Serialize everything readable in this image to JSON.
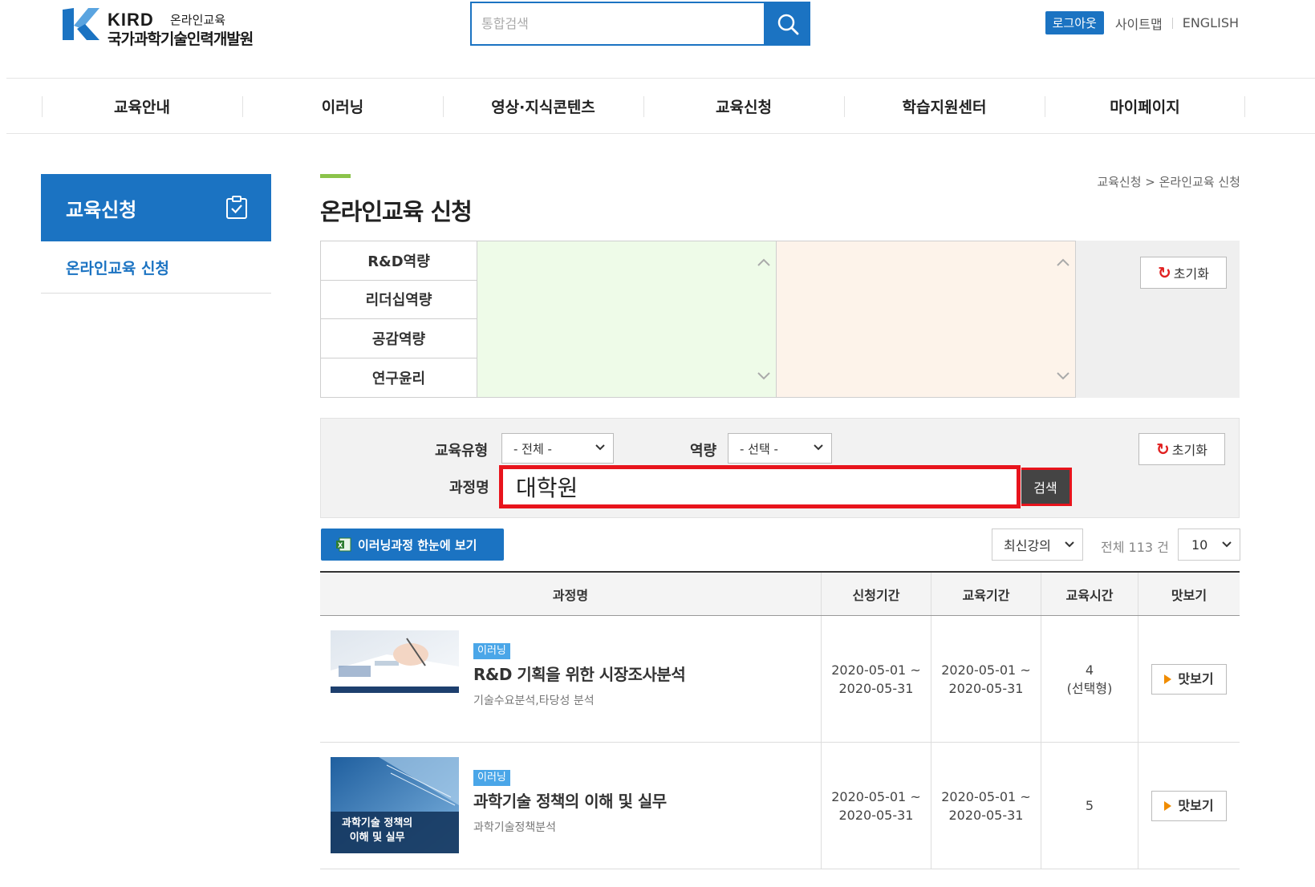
{
  "header": {
    "logo_kird": "KIRD",
    "logo_online": "온라인교육",
    "logo_name": "국가과학기술인력개발원",
    "search_placeholder": "통합검색",
    "logout": "로그아웃",
    "sitemap": "사이트맵",
    "english": "ENGLISH",
    "accent_color": "#1b73c2"
  },
  "gnb": [
    "교육안내",
    "이러닝",
    "영상·지식콘텐츠",
    "교육신청",
    "학습지원센터",
    "마이페이지"
  ],
  "sidebar": {
    "title": "교육신청",
    "items": [
      "온라인교육 신청"
    ]
  },
  "page": {
    "title": "온라인교육 신청",
    "breadcrumb": "교육신청 > 온라인교육 신청"
  },
  "competency": {
    "items": [
      "R&D역량",
      "리더십역량",
      "공감역량",
      "연구윤리"
    ],
    "reset": "초기화"
  },
  "filter": {
    "type_label": "교육유형",
    "type_value": "- 전체 -",
    "comp_label": "역량",
    "comp_value": "- 선택 -",
    "name_label": "과정명",
    "keyword": "대학원",
    "search": "검색",
    "reset": "초기화"
  },
  "toolbar": {
    "excel": "이러닝과정 한눈에 보기",
    "sort": "최신강의",
    "total": "전체 113 건",
    "page_size": "10"
  },
  "table": {
    "headers": [
      "과정명",
      "신청기간",
      "교육기간",
      "교육시간",
      "맛보기"
    ],
    "rows": [
      {
        "badge": "이러닝",
        "title": "R&D 기획을 위한 시장조사분석",
        "sub": "기술수요분석,타당성 분석",
        "apply_start": "2020-05-01 ~",
        "apply_end": "2020-05-31",
        "edu_start": "2020-05-01 ~",
        "edu_end": "2020-05-31",
        "hours": "4",
        "hours_note": "(선택형)",
        "preview": "맛보기"
      },
      {
        "badge": "이러닝",
        "title": "과학기술 정책의 이해 및 실무",
        "sub": "과학기술정책분석",
        "thumb_text_1": "과학기술 정책의",
        "thumb_text_2": "이해 및 실무",
        "apply_start": "2020-05-01 ~",
        "apply_end": "2020-05-31",
        "edu_start": "2020-05-01 ~",
        "edu_end": "2020-05-31",
        "hours": "5",
        "hours_note": "",
        "preview": "맛보기"
      }
    ]
  }
}
